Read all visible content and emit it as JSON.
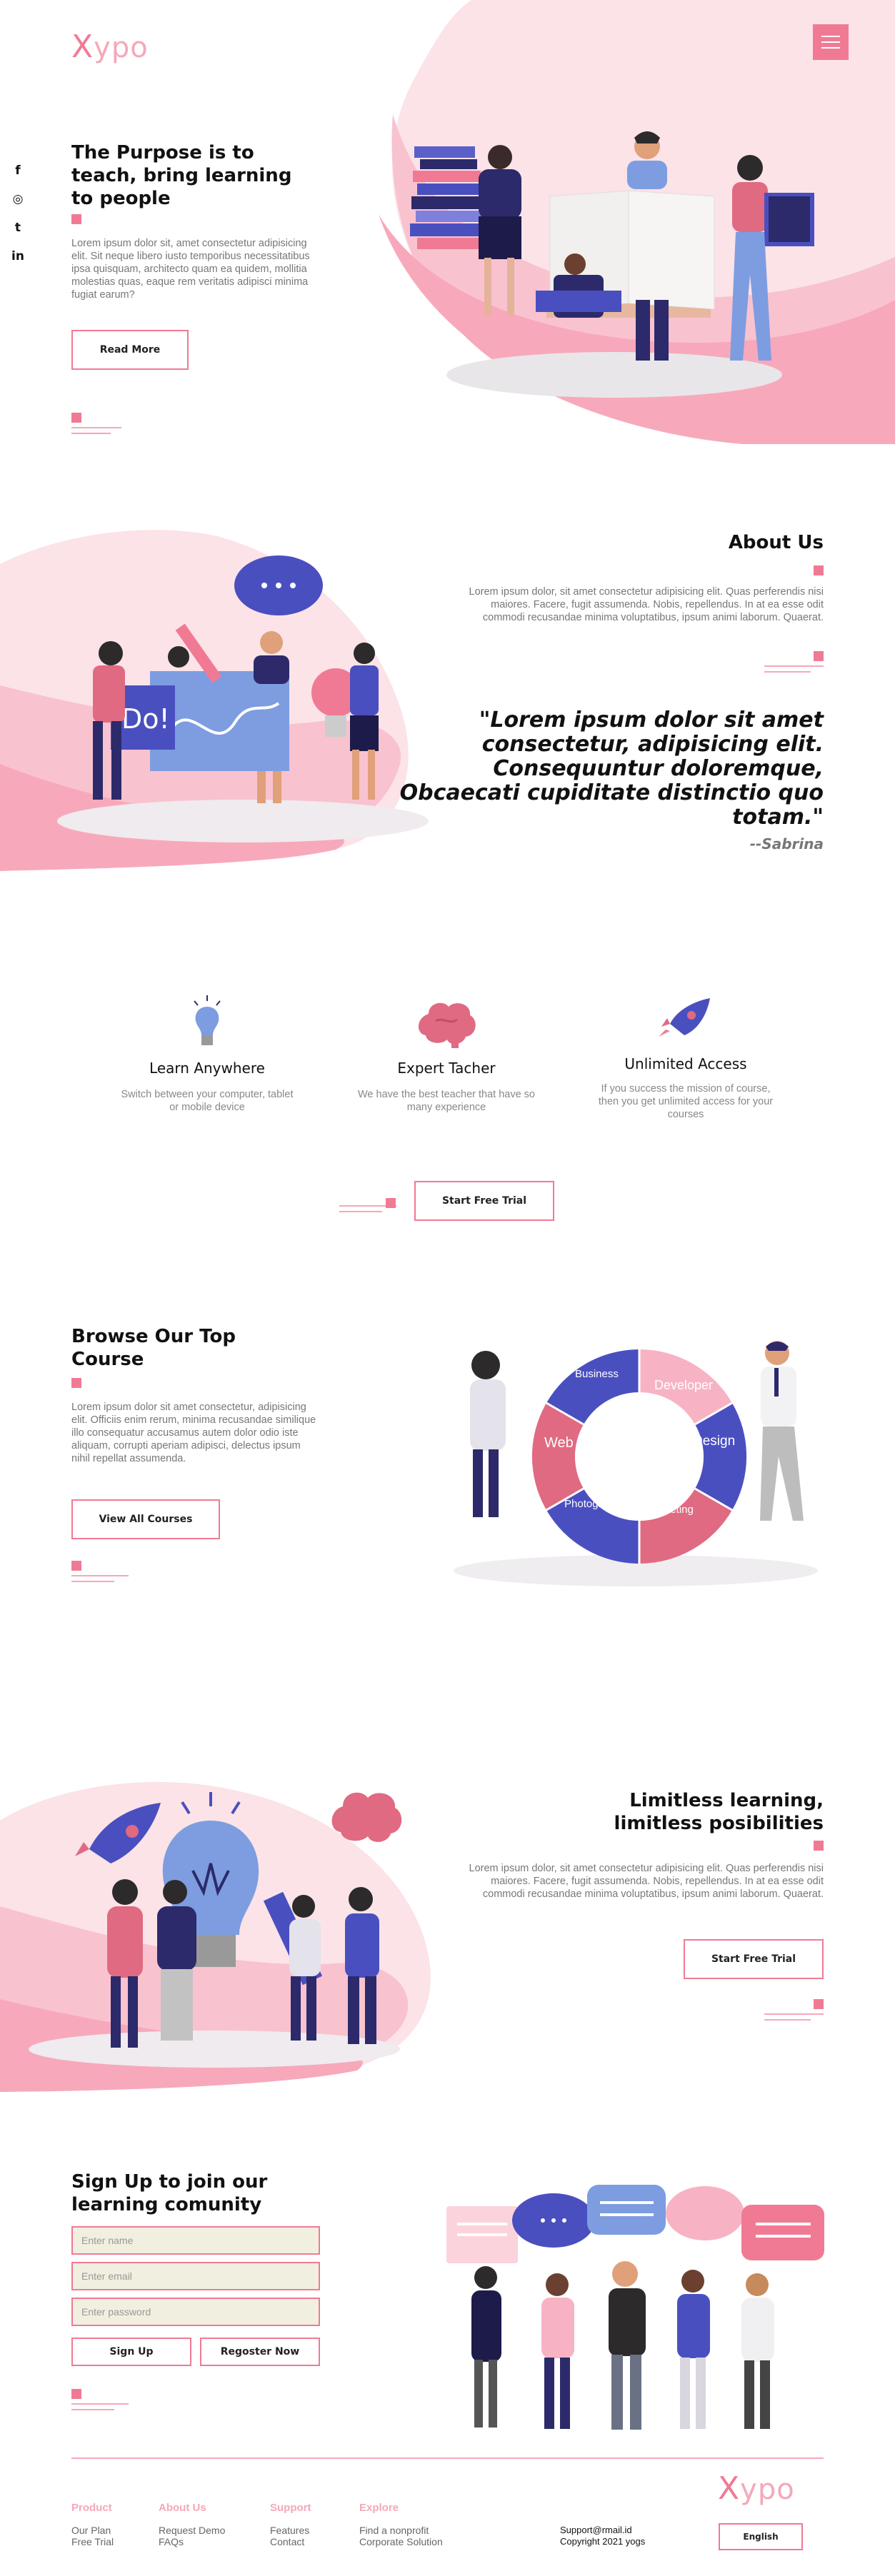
{
  "brand": {
    "logo_x": "X",
    "logo_rest": "ypo"
  },
  "social": [
    "f",
    "◎",
    "t",
    "in"
  ],
  "hero": {
    "title": "The Purpose is to teach, bring learning to people",
    "text": "Lorem ipsum dolor sit, amet consectetur adipisicing elit. Sit neque libero iusto temporibus necessitatibus ipsa quisquam, architecto quam ea quidem, mollitia molestias quas, eaque rem veritatis adipisci minima fugiat earum?",
    "button": "Read More"
  },
  "about": {
    "title": "About Us",
    "text": "Lorem ipsum dolor, sit amet consectetur adipisicing elit. Quas perferendis nisi maiores. Facere, fugit assumenda. Nobis, repellendus. In at ea esse odit commodi recusandae minima voluptatibus, ipsum animi laborum. Quaerat.",
    "quote": "\"Lorem ipsum dolor sit amet consectetur, adipisicing elit. Consequuntur doloremque, Obcaecati cupiditate distinctio quo totam.\"",
    "author": "--Sabrina"
  },
  "features": [
    {
      "title": "Learn Anywhere",
      "desc": "Switch between your computer, tablet or mobile device"
    },
    {
      "title": "Expert Tacher",
      "desc": "We have the best teacher that have so many experience"
    },
    {
      "title": "Unlimited Access",
      "desc": "If you success the mission of course, then you get unlimited access for your courses"
    }
  ],
  "trial_button": "Start Free Trial",
  "courses": {
    "title": "Browse Our Top Course",
    "text": "Lorem ipsum dolor sit amet consectetur, adipisicing elit. Officiis enim rerum, minima recusandae similique illo consequatur accusamus autem dolor odio iste aliquam, corrupti aperiam adipisci, delectus ipsum nihil repellat assumenda.",
    "button": "View All Courses",
    "wheel": [
      "Business",
      "Developer",
      "Design",
      "Marketing",
      "Photography",
      "Web"
    ]
  },
  "limitless": {
    "title": "Limitless learning, limitless posibilities",
    "text": "Lorem ipsum dolor, sit amet consectetur adipisicing elit. Quas perferendis nisi maiores. Facere, fugit assumenda. Nobis, repellendus. In at ea esse odit commodi recusandae minima voluptatibus, ipsum animi laborum. Quaerat.",
    "button": "Start Free Trial"
  },
  "signup": {
    "title": "Sign Up to join our learning comunity",
    "name_placeholder": "Enter name",
    "email_placeholder": "Enter email",
    "password_placeholder": "Enter password",
    "signup_button": "Sign Up",
    "register_button": "Regoster Now"
  },
  "footer": {
    "columns": [
      {
        "heading": "Product",
        "links": [
          "Our Plan",
          "Free Trial"
        ]
      },
      {
        "heading": "About Us",
        "links": [
          "Request Demo",
          "FAQs"
        ]
      },
      {
        "heading": "Support",
        "links": [
          "Features",
          "Contact"
        ]
      },
      {
        "heading": "Explore",
        "links": [
          "Find a nonprofit",
          "Corporate Solution"
        ]
      }
    ],
    "email": "Support@rmail.id",
    "copyright": "Copyright 2021 yogs",
    "language": "English"
  },
  "colors": {
    "accent": "#f07a94",
    "accent_light": "#f5a8b8",
    "indigo": "#4a4fc0",
    "blob": "#fbd3dc"
  }
}
